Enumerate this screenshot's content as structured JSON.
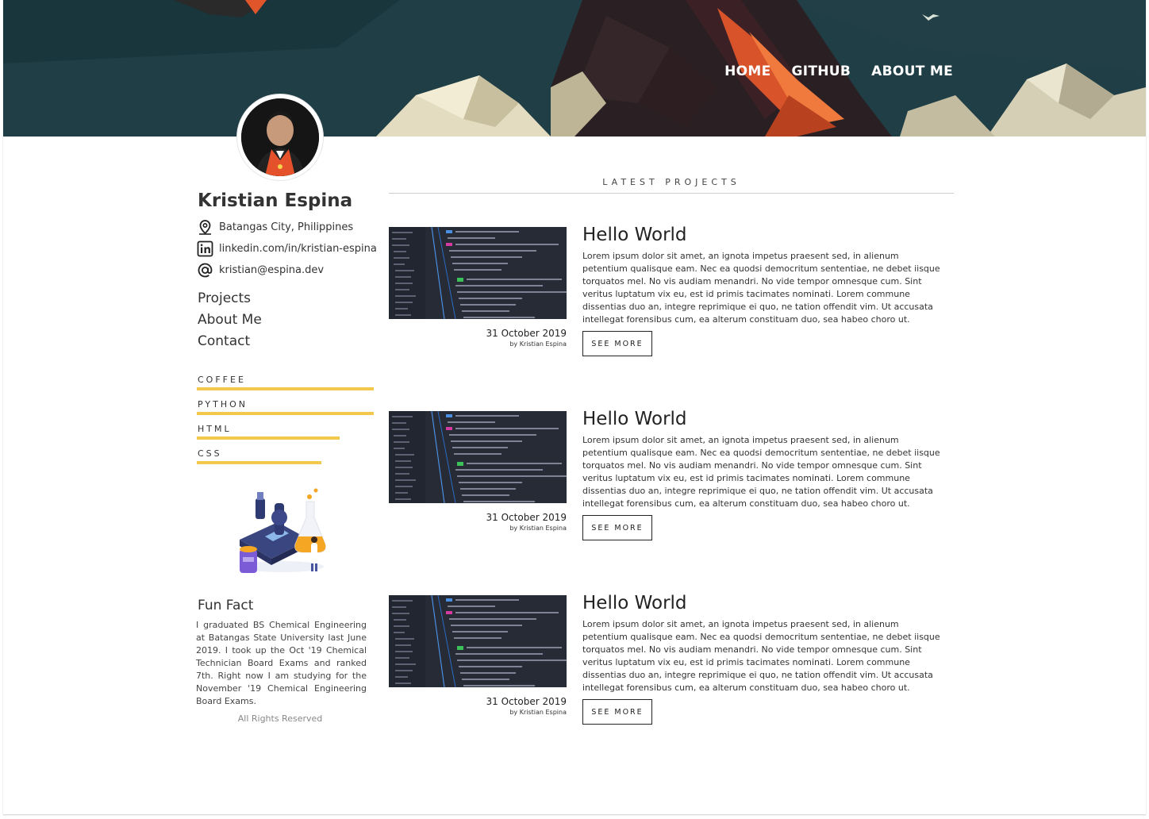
{
  "nav": {
    "items": [
      {
        "label": "HOME"
      },
      {
        "label": "GITHUB"
      },
      {
        "label": "ABOUT ME"
      }
    ]
  },
  "profile": {
    "name": "Kristian Espina",
    "location": "Batangas City, Philippines",
    "linkedin": "linkedin.com/in/kristian-espina",
    "email": "kristian@espina.dev"
  },
  "side_nav": {
    "items": [
      {
        "label": "Projects"
      },
      {
        "label": "About Me"
      },
      {
        "label": "Contact"
      }
    ]
  },
  "skills": [
    {
      "label": "COFFEE",
      "level": 1.0
    },
    {
      "label": "PYTHON",
      "level": 1.0
    },
    {
      "label": "HTML",
      "level": 0.8
    },
    {
      "label": "CSS",
      "level": 0.7
    }
  ],
  "fun_fact": {
    "title": "Fun Fact",
    "text": "I graduated BS Chemical Engineering at Batangas State University last June 2019. I took up the Oct '19 Chemical Technician Board Exams and ranked 7th. Right now I am studying for the November '19 Chemical Engineering Board Exams."
  },
  "footer": {
    "text": "All Rights Reserved"
  },
  "projects": {
    "section_title": "LATEST PROJECTS",
    "items": [
      {
        "title": "Hello World",
        "body": "Lorem ipsum dolor sit amet, an ignota impetus praesent sed, in alienum petentium qualisque eam. Nec ea quodsi democritum sententiae, ne debet iisque torquatos mel. No vis audiam menandri. No vide tempor omnesque cum. Sint veritus luptatum vix eu, est id primis tacimates nominati. Lorem commune dissentias duo an, integre reprimique ei quo, ne tation offendit vim. Ut accusata intellegat forensibus cum, ea alterum constituam duo, sea habeo choro ut.",
        "date": "31 October 2019",
        "author": "by Kristian Espina",
        "button": "SEE MORE"
      },
      {
        "title": "Hello World",
        "body": "Lorem ipsum dolor sit amet, an ignota impetus praesent sed, in alienum petentium qualisque eam. Nec ea quodsi democritum sententiae, ne debet iisque torquatos mel. No vis audiam menandri. No vide tempor omnesque cum. Sint veritus luptatum vix eu, est id primis tacimates nominati. Lorem commune dissentias duo an, integre reprimique ei quo, ne tation offendit vim. Ut accusata intellegat forensibus cum, ea alterum constituam duo, sea habeo choro ut.",
        "date": "31 October 2019",
        "author": "by Kristian Espina",
        "button": "SEE MORE"
      },
      {
        "title": "Hello World",
        "body": "Lorem ipsum dolor sit amet, an ignota impetus praesent sed, in alienum petentium qualisque eam. Nec ea quodsi democritum sententiae, ne debet iisque torquatos mel. No vis audiam menandri. No vide tempor omnesque cum. Sint veritus luptatum vix eu, est id primis tacimates nominati. Lorem commune dissentias duo an, integre reprimique ei quo, ne tation offendit vim. Ut accusata intellegat forensibus cum, ea alterum constituam duo, sea habeo choro ut.",
        "date": "31 October 2019",
        "author": "by Kristian Espina",
        "button": "SEE MORE"
      }
    ]
  },
  "colors": {
    "hero_bg": "#1d3b43",
    "skill_bar": "#f2c94c",
    "accent_orange": "#e8683a",
    "thumb_bg": "#262b36"
  }
}
